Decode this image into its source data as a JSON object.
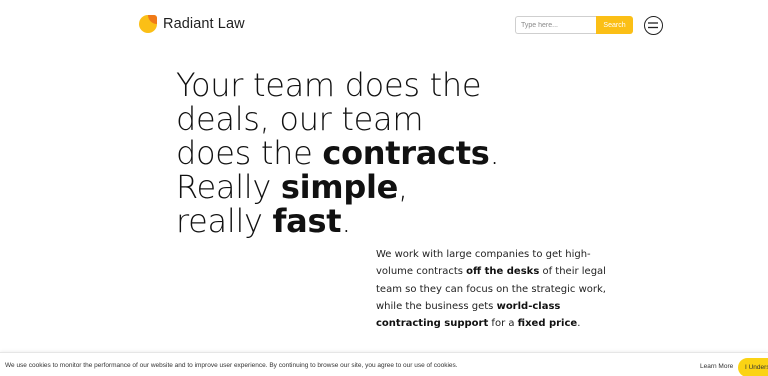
{
  "header": {
    "brand_name": "Radiant Law",
    "logo_colors": {
      "outer": "#fbbf16",
      "inner": "#f07a18"
    },
    "search": {
      "placeholder": "Type here...",
      "button_label": "Search"
    },
    "menu_icon": "hamburger-icon"
  },
  "hero": {
    "lines": [
      {
        "light": "Your team does the"
      },
      {
        "light": "deals, our team"
      },
      {
        "light": "does the ",
        "bold": "contracts",
        "after": "."
      },
      {
        "light": "Really ",
        "bold": "simple",
        "after": ","
      },
      {
        "light": "really ",
        "bold": "fast",
        "after": "."
      }
    ]
  },
  "intro": {
    "p1": "We work with large companies to get high-volume contracts ",
    "b1": "off the desks",
    "p2": " of their legal team so they can focus on the strategic work, while the business gets ",
    "b2": "world-class contracting support",
    "p3": " for a ",
    "b3": "fixed price",
    "p4": "."
  },
  "cookie_bar": {
    "message": "We use cookies to monitor the performance of our website and to improve user experience. By continuing to browse our site, you agree to our use of cookies.",
    "learn_more": "Learn More",
    "accept": "I Understand"
  },
  "colors": {
    "accent": "#fbbf16",
    "cookie_accent": "#fbd314",
    "text": "#111111"
  }
}
